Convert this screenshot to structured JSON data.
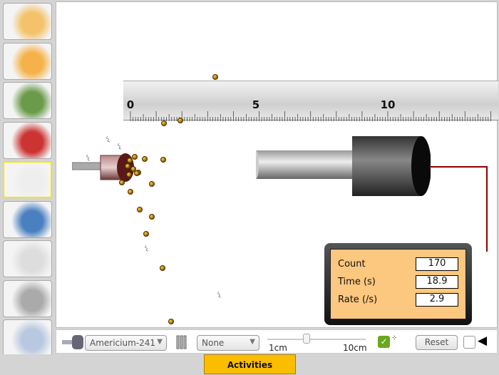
{
  "sidebar": {
    "items": [
      {
        "name": "scattering"
      },
      {
        "name": "nucleus-zoom"
      },
      {
        "name": "nucleus-decay"
      },
      {
        "name": "cube-3d"
      },
      {
        "name": "source-detector",
        "selected": true
      },
      {
        "name": "atom-lattice"
      },
      {
        "name": "half-life"
      },
      {
        "name": "decay-chain"
      },
      {
        "name": "particles-cloud"
      }
    ]
  },
  "ruler": {
    "labels": [
      "0",
      "5",
      "10"
    ],
    "unit_values": [
      0,
      5,
      10
    ]
  },
  "counter": {
    "count_label": "Count",
    "count_value": "170",
    "time_label": "Time (s)",
    "time_value": "18.9",
    "rate_label": "Rate (/s)",
    "rate_value": "2.9"
  },
  "controls": {
    "source_select": "Americium-241",
    "absorber_select": "None",
    "distance_min_label": "1cm",
    "distance_max_label": "10cm",
    "distance_value_cm": 4.5,
    "show_radiation_checked": true,
    "reset_label": "Reset",
    "sound_checked": false
  },
  "footer": {
    "activities_label": "Activities"
  },
  "colors": {
    "accent": "#fbbd00",
    "wire": "#8b0000",
    "counter_bg": "#fcc77f",
    "selected_border": "#f5e600"
  }
}
